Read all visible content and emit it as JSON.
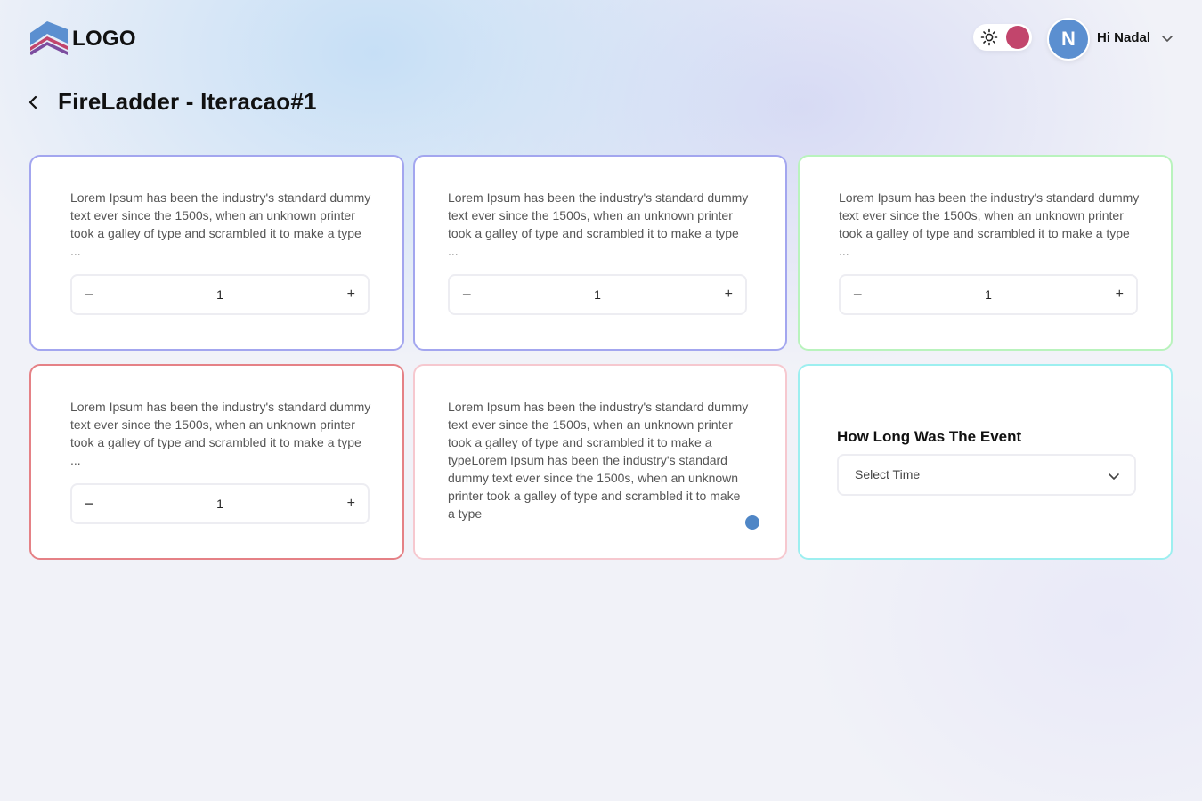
{
  "header": {
    "logo_text": "LOGO",
    "greeting": "Hi Nadal",
    "avatar_initial": "N",
    "toggle_color": "#c2456c"
  },
  "page": {
    "title": "FireLadder - Iteracao#1"
  },
  "cards": [
    {
      "text": "Lorem Ipsum has been the industry's standard dummy text ever since the 1500s, when an unknown printer took a galley of type and scrambled it to make a type ...",
      "stepper": {
        "minus": "−",
        "value": "1",
        "plus": "+"
      },
      "border_color": "#a3a6ef"
    },
    {
      "text": "Lorem Ipsum has been the industry's standard dummy text ever since the 1500s, when an unknown printer took a galley of type and scrambled it to make a type ...",
      "stepper": {
        "minus": "−",
        "value": "1",
        "plus": "+"
      },
      "border_color": "#a3a6ef"
    },
    {
      "text": "Lorem Ipsum has been the industry's standard dummy text ever since the 1500s, when an unknown printer took a galley of type and scrambled it to make a type ...",
      "stepper": {
        "minus": "−",
        "value": "1",
        "plus": "+"
      },
      "border_color": "#b9f3bd"
    },
    {
      "text": "Lorem Ipsum has been the industry's standard dummy text ever since the 1500s, when an unknown printer took a galley of type and scrambled it to make a type ...",
      "stepper": {
        "minus": "−",
        "value": "1",
        "plus": "+"
      },
      "border_color": "#e58186"
    },
    {
      "text": "Lorem Ipsum has been the industry's standard dummy text ever since the 1500s, when an unknown printer took a galley of type and scrambled it to make a typeLorem Ipsum has been the industry's standard dummy text ever since the 1500s, when an unknown printer took a galley of type and scrambled it to make a type",
      "border_color": "#f6c8cf"
    },
    {
      "question": "How Long Was The Event",
      "select": {
        "value": "Select Time",
        "icon": "chevron-down-icon"
      },
      "border_color": "#9deff0"
    }
  ],
  "icons": {
    "theme": "sun-icon",
    "user_menu": "chevron-down-icon",
    "back": "chevron-left-icon"
  }
}
